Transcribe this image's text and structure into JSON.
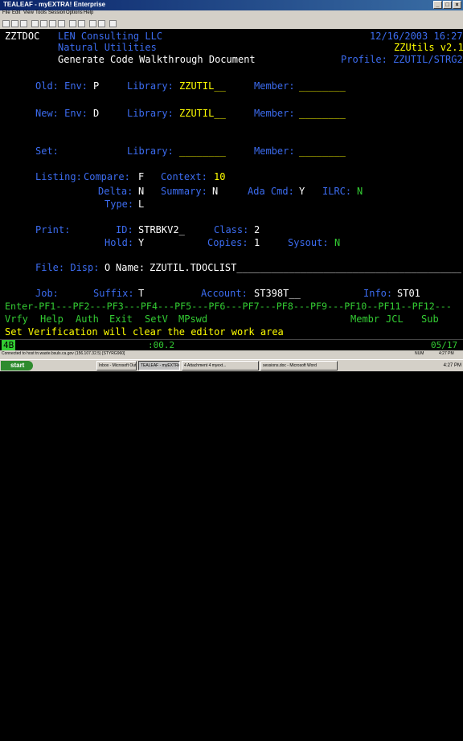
{
  "window": {
    "title": "TEALEAF - myEXTRA! Enterprise",
    "menu": [
      "File",
      "Edit",
      "View",
      "Tools",
      "Session",
      "Options",
      "Help"
    ]
  },
  "header": {
    "program": "ZZTDOC",
    "company": "LEN Consulting LLC",
    "datetime": "12/16/2003 16:27",
    "subtitle": "Natural Utilities",
    "version": "ZZUtils v2.1",
    "title": "Generate Code Walkthrough Document",
    "profile": "Profile: ZZUTIL/STRG2"
  },
  "old": {
    "env_label": "Old: Env:",
    "env": "P",
    "library_label": "Library:",
    "library": "ZZUTIL__",
    "member_label": "Member:",
    "member": "________"
  },
  "new": {
    "env_label": "New: Env:",
    "env": "D",
    "library_label": "Library:",
    "library": "ZZUTIL__",
    "member_label": "Member:",
    "member": "________"
  },
  "set": {
    "label": "Set:",
    "library_label": "Library:",
    "library": "________",
    "member_label": "Member:",
    "member": "________"
  },
  "listing": {
    "label": "Listing:",
    "compare_label": "Compare:",
    "compare": "F",
    "context_label": "Context:",
    "context": "10",
    "delta_label": "Delta:",
    "delta": "N",
    "summary_label": "Summary:",
    "summary": "N",
    "adacmd_label": "Ada Cmd:",
    "adacmd": "Y",
    "ilrc_label": "ILRC:",
    "ilrc": "N",
    "type_label": "Type:",
    "type": "L"
  },
  "print": {
    "label": "Print:",
    "id_label": "ID:",
    "id": "STRBKV2_",
    "class_label": "Class:",
    "class": "2",
    "hold_label": "Hold:",
    "hold": "Y",
    "copies_label": "Copies:",
    "copies": "1",
    "sysout_label": "Sysout:",
    "sysout": "N"
  },
  "file": {
    "label": "File: Disp:",
    "disp": "O",
    "name_label": "Name:",
    "name": "ZZUTIL.TDOCLIST________________________________________"
  },
  "job": {
    "label": "Job:",
    "suffix_label": "Suffix:",
    "suffix": "T",
    "account_label": "Account:",
    "account": "ST398T__",
    "info_label": "Info:",
    "info": "ST01"
  },
  "pf_header": "Enter-PF1---PF2---PF3---PF4---PF5---PF6---PF7---PF8---PF9---PF10--PF11--PF12---",
  "pf_keys": {
    "pf1": "Vrfy",
    "pf2": "Help",
    "pf3": "Auth",
    "pf4": "Exit",
    "pf5": "SetV",
    "pf6": "MPswd",
    "pf10": "Membr",
    "pf11": "JCL",
    "pf12": "Sub"
  },
  "message": "Set Verification will clear the editor work area",
  "status": {
    "session": "4B",
    "indicator": ":00.2",
    "cursor": "05/17"
  },
  "infobar": {
    "connection": "Connected to host tn.waste.bsuls.ca.gov (156.107.32.5) [STYRG960]",
    "num": "NUM",
    "time": "4:27 PM"
  },
  "taskbar": {
    "start": "start",
    "tasks": [
      "Inbox - Microsoft Outl...",
      "TEALEAF - myEXTRA...",
      "4 Attachment 4 myext...",
      "sessions.doc - Microsoft Word"
    ],
    "clock": "4:27 PM"
  }
}
